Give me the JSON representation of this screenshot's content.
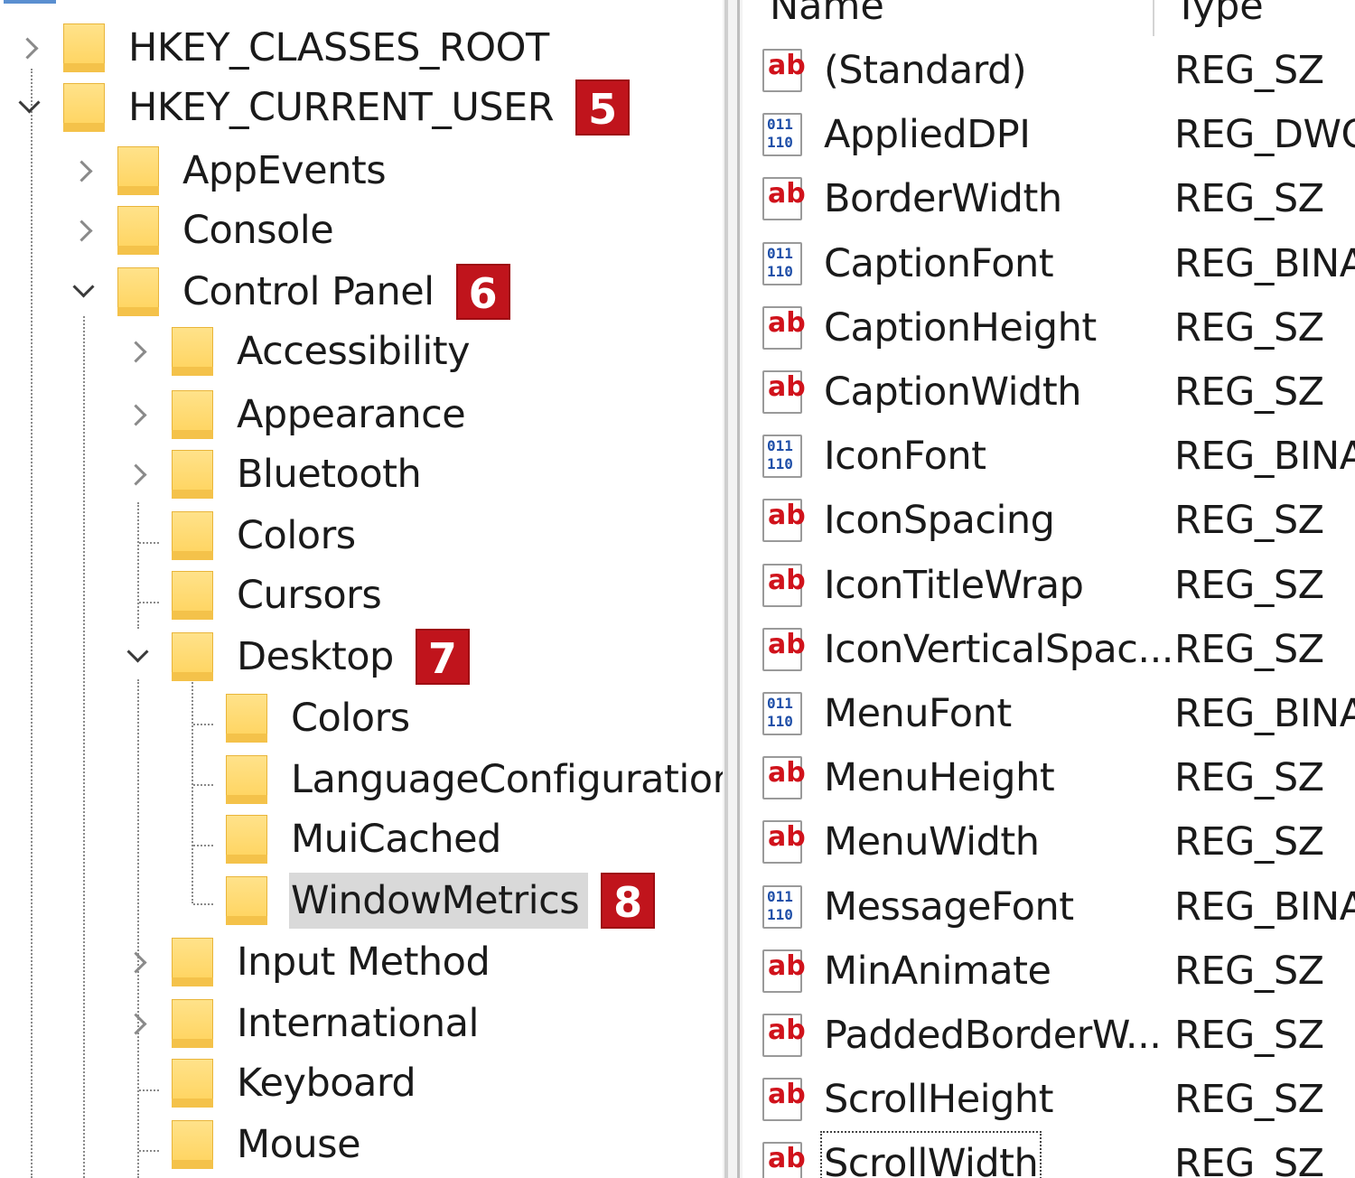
{
  "tree": {
    "nodes": [
      {
        "key": "hkcr",
        "label": "HKEY_CLASSES_ROOT",
        "expander": "collapsed",
        "level": 0
      },
      {
        "key": "hkcu",
        "label": "HKEY_CURRENT_USER",
        "expander": "expanded",
        "level": 0,
        "badge": "5"
      },
      {
        "key": "appevents",
        "label": "AppEvents",
        "expander": "collapsed",
        "level": 1
      },
      {
        "key": "console",
        "label": "Console",
        "expander": "collapsed",
        "level": 1
      },
      {
        "key": "controlpanel",
        "label": "Control Panel",
        "expander": "expanded",
        "level": 1,
        "badge": "6"
      },
      {
        "key": "accessibility",
        "label": "Accessibility",
        "expander": "collapsed",
        "level": 2
      },
      {
        "key": "appearance",
        "label": "Appearance",
        "expander": "collapsed",
        "level": 2
      },
      {
        "key": "bluetooth",
        "label": "Bluetooth",
        "expander": "collapsed",
        "level": 2
      },
      {
        "key": "colors",
        "label": "Colors",
        "expander": "none",
        "level": 2
      },
      {
        "key": "cursors",
        "label": "Cursors",
        "expander": "none",
        "level": 2
      },
      {
        "key": "desktop",
        "label": "Desktop",
        "expander": "expanded",
        "level": 2,
        "badge": "7"
      },
      {
        "key": "desktop-colors",
        "label": "Colors",
        "expander": "none",
        "level": 3
      },
      {
        "key": "languageconfiguration",
        "label": "LanguageConfiguration",
        "expander": "none",
        "level": 3
      },
      {
        "key": "muicached",
        "label": "MuiCached",
        "expander": "none",
        "level": 3
      },
      {
        "key": "windowmetrics",
        "label": "WindowMetrics",
        "expander": "none",
        "level": 3,
        "badge": "8",
        "selected": true
      },
      {
        "key": "inputmethod",
        "label": "Input Method",
        "expander": "collapsed",
        "level": 2
      },
      {
        "key": "international",
        "label": "International",
        "expander": "collapsed",
        "level": 2
      },
      {
        "key": "keyboard",
        "label": "Keyboard",
        "expander": "none",
        "level": 2
      },
      {
        "key": "mouse",
        "label": "Mouse",
        "expander": "none",
        "level": 2
      }
    ]
  },
  "values": {
    "header": {
      "name": "Name",
      "type": "Type"
    },
    "rows": [
      {
        "name": "(Standard)",
        "type": "REG_SZ",
        "icon": "string-value-icon"
      },
      {
        "name": "AppliedDPI",
        "type": "REG_DWORD",
        "icon": "binary-value-icon"
      },
      {
        "name": "BorderWidth",
        "type": "REG_SZ",
        "icon": "string-value-icon"
      },
      {
        "name": "CaptionFont",
        "type": "REG_BINARY",
        "icon": "binary-value-icon"
      },
      {
        "name": "CaptionHeight",
        "type": "REG_SZ",
        "icon": "string-value-icon"
      },
      {
        "name": "CaptionWidth",
        "type": "REG_SZ",
        "icon": "string-value-icon"
      },
      {
        "name": "IconFont",
        "type": "REG_BINARY",
        "icon": "binary-value-icon"
      },
      {
        "name": "IconSpacing",
        "type": "REG_SZ",
        "icon": "string-value-icon"
      },
      {
        "name": "IconTitleWrap",
        "type": "REG_SZ",
        "icon": "string-value-icon"
      },
      {
        "name": "IconVerticalSpac...",
        "type": "REG_SZ",
        "icon": "string-value-icon"
      },
      {
        "name": "MenuFont",
        "type": "REG_BINARY",
        "icon": "binary-value-icon"
      },
      {
        "name": "MenuHeight",
        "type": "REG_SZ",
        "icon": "string-value-icon"
      },
      {
        "name": "MenuWidth",
        "type": "REG_SZ",
        "icon": "string-value-icon"
      },
      {
        "name": "MessageFont",
        "type": "REG_BINARY",
        "icon": "binary-value-icon"
      },
      {
        "name": "MinAnimate",
        "type": "REG_SZ",
        "icon": "string-value-icon"
      },
      {
        "name": "PaddedBorderW...",
        "type": "REG_SZ",
        "icon": "string-value-icon"
      },
      {
        "name": "ScrollHeight",
        "type": "REG_SZ",
        "icon": "string-value-icon"
      },
      {
        "name": "ScrollWidth",
        "type": "REG_SZ",
        "icon": "string-value-icon",
        "focused": true
      }
    ]
  },
  "colors": {
    "badge": "#c0141c",
    "folder": "#ffd35c",
    "selection": "#d9d9d9",
    "string_icon": "#d0121b",
    "binary_icon": "#1f4fa8"
  }
}
